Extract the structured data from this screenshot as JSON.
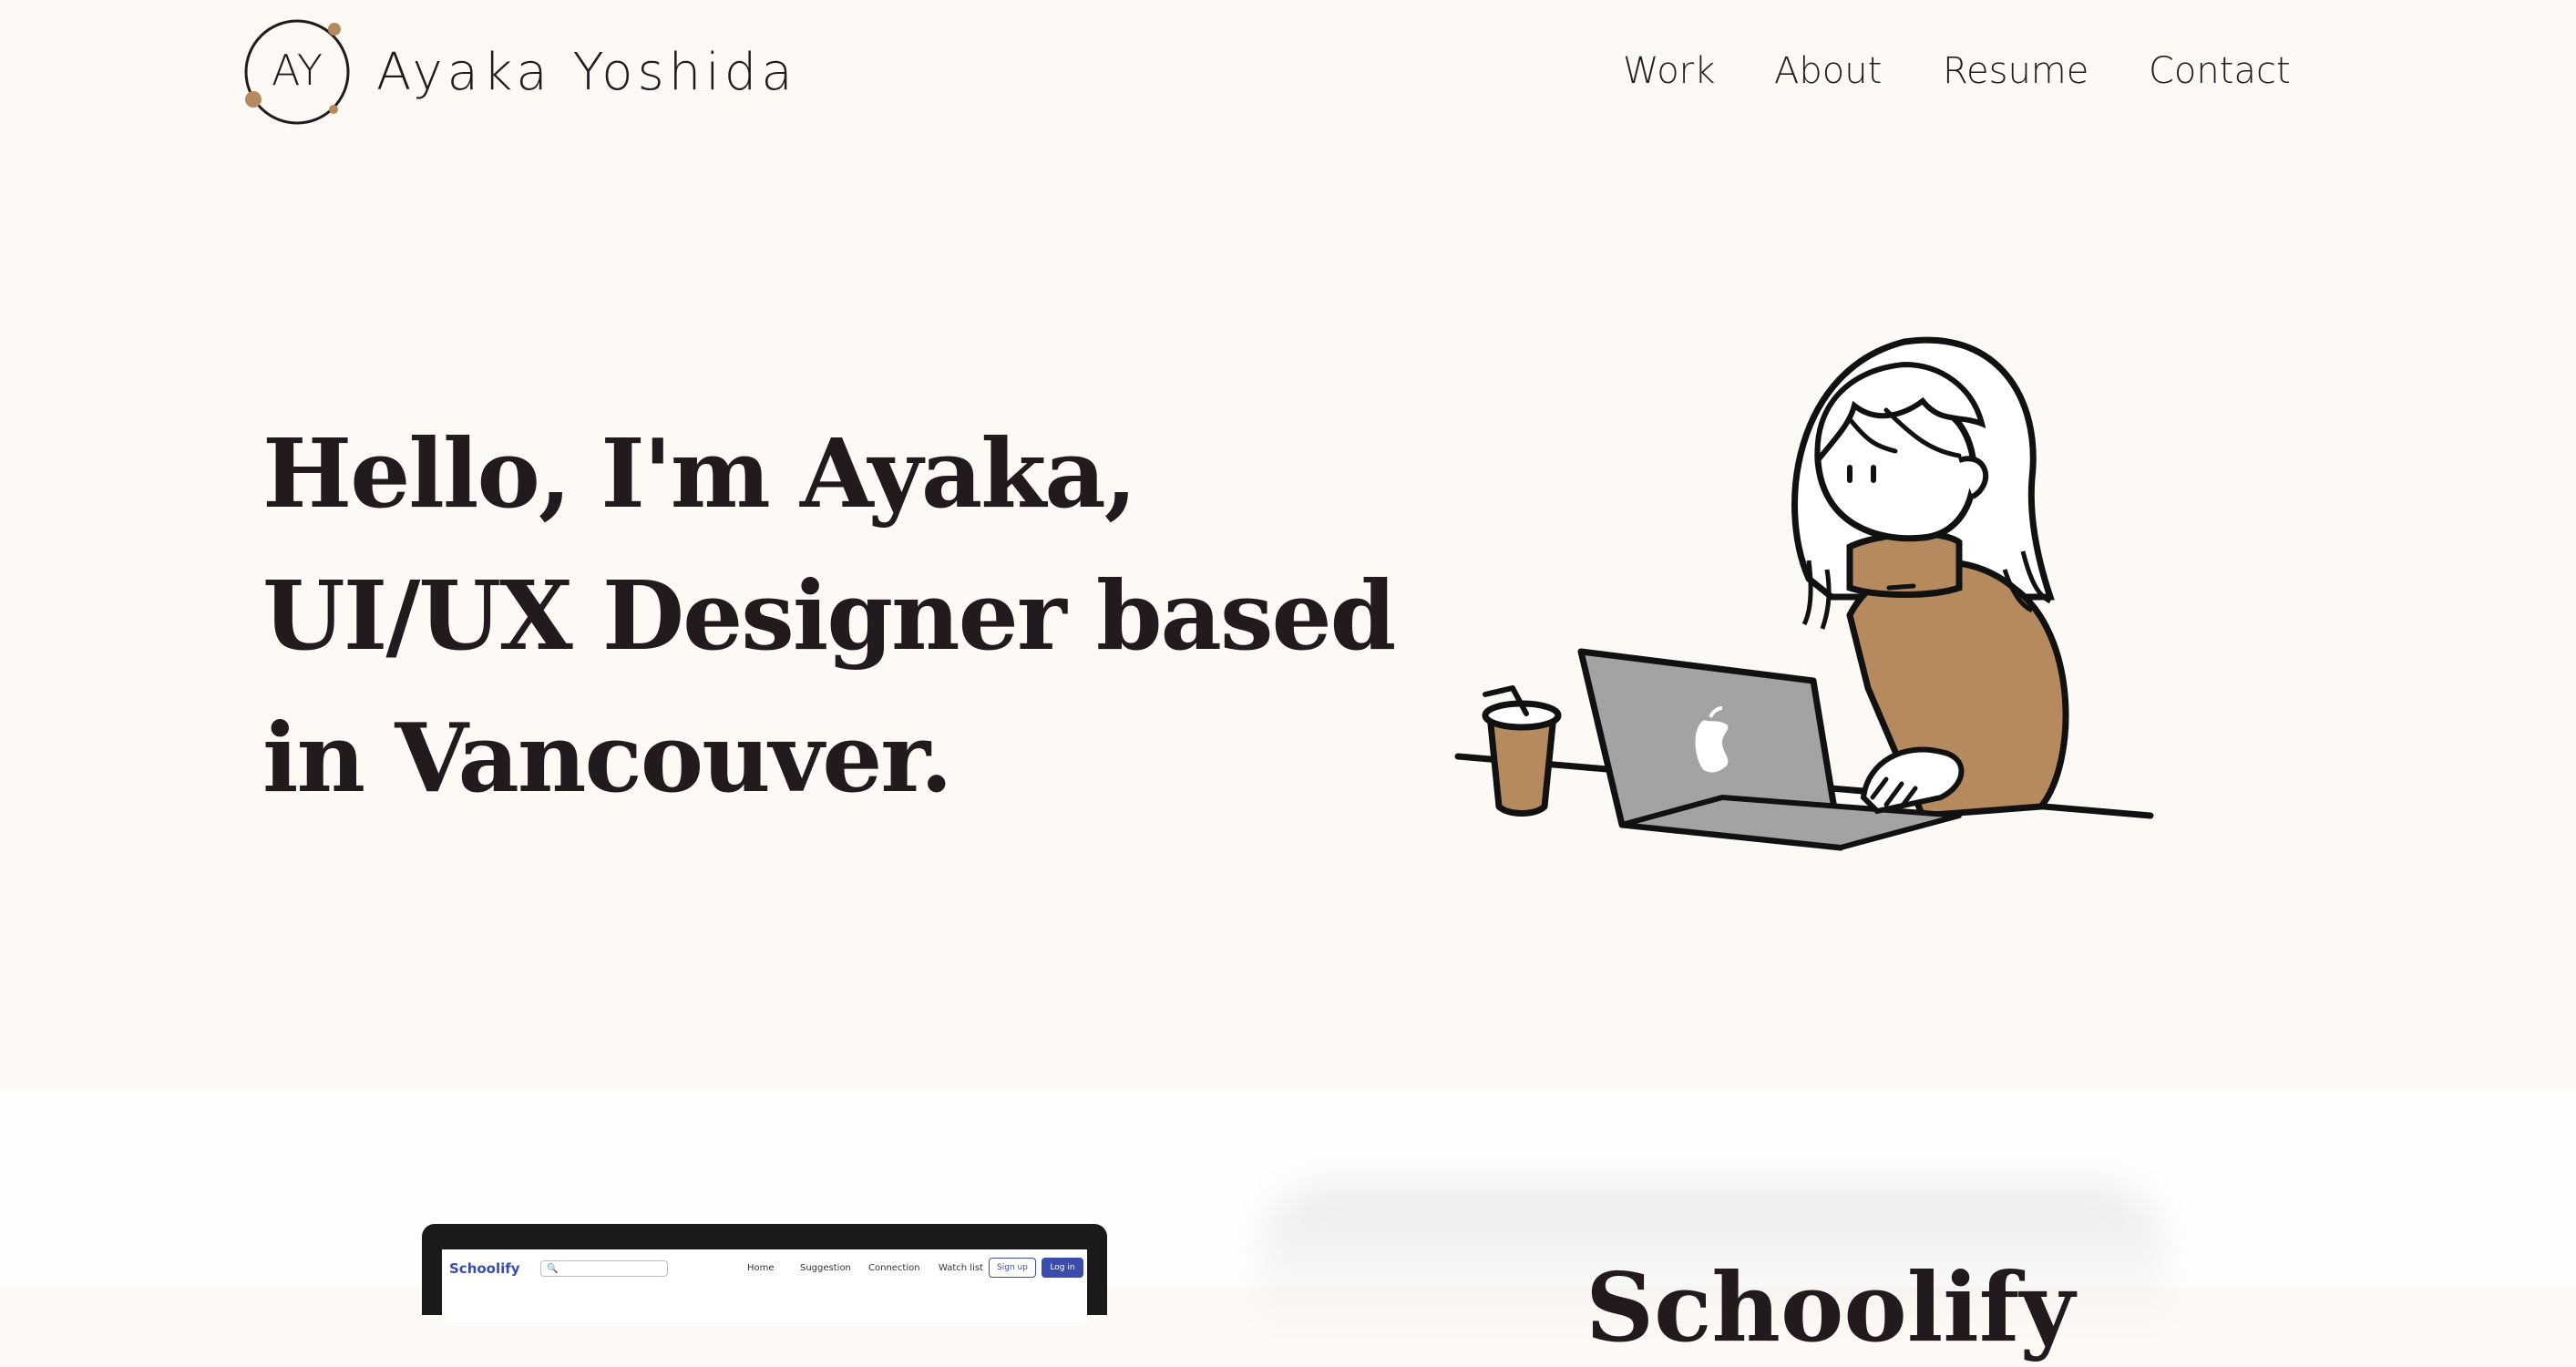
{
  "header": {
    "logo_text": "AY",
    "brand_name": "Ayaka Yoshida",
    "nav": [
      "Work",
      "About",
      "Resume",
      "Contact"
    ]
  },
  "hero": {
    "lines": [
      "Hello, I'm Ayaka,",
      "UI/UX Designer based",
      "in Vancouver."
    ]
  },
  "project": {
    "title": "Schoolify",
    "screen": {
      "logo": "Schoolify",
      "nav": [
        "Home",
        "Suggestion",
        "Connection",
        "Watch list"
      ],
      "signup": "Sign up",
      "login": "Log in"
    }
  },
  "colors": {
    "background": "#fdf9f5",
    "text": "#231a1d",
    "accent_brown": "#b58a5f",
    "laptop_gray": "#a3a3a3",
    "screen_blue": "#3a4cae"
  }
}
